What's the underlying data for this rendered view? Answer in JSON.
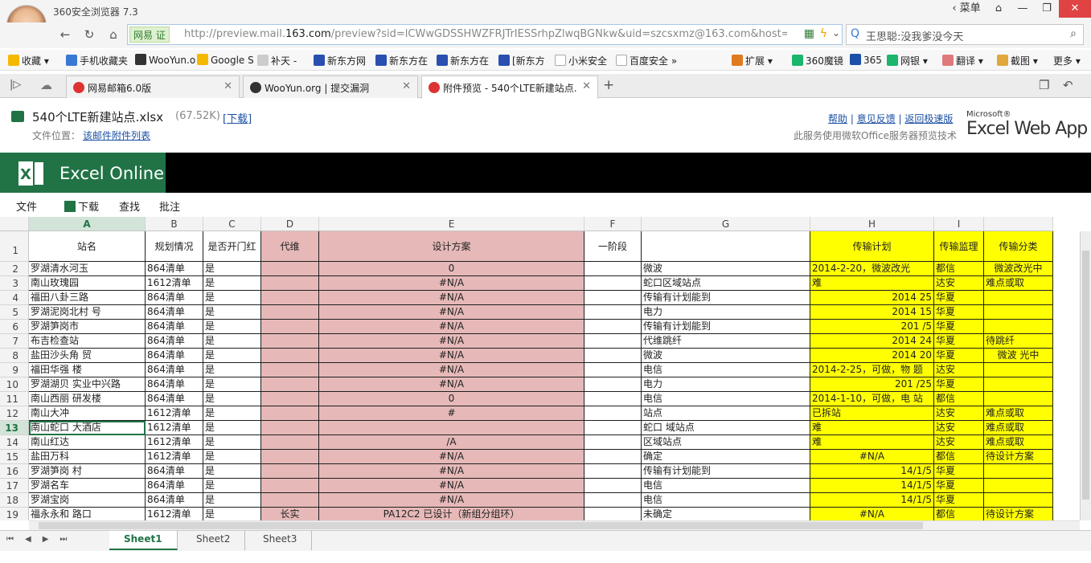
{
  "browser": {
    "app_title": "360安全浏览器 7.3",
    "url_badge": "网易 证",
    "url_prefix": "http://preview.mail.",
    "url_domain": "163.com",
    "url_suffix": "/preview?sid=lCWwGDSSHWZFRJTrIESSrhpZlwqBGNkw&uid=szcsxmz@163.com&host=",
    "search_text": "王思聪:没我爹没今天",
    "win_buttons": [
      "‹ 菜单",
      "⌂",
      "—",
      "❐",
      "✕"
    ]
  },
  "bookmarks": [
    "收藏",
    "手机收藏夹",
    "WooYun.o",
    "Google S",
    "补天",
    "新东方网",
    "新东方在",
    "新东方在",
    "[新东方",
    "小米安全",
    "百度安全",
    "扩展",
    "360魔镜",
    "365",
    "网银",
    "翻译",
    "截图",
    "更多"
  ],
  "tabs": [
    {
      "label": "网易邮箱6.0版",
      "icon_color": "#d33"
    },
    {
      "label": "WooYun.org | 提交漏洞",
      "icon_color": "#333"
    },
    {
      "label": "附件预览 - 540个LTE新建站点.",
      "icon_color": "#d33"
    }
  ],
  "file": {
    "name": "540个LTE新建站点.xlsx",
    "size": "(67.52K)",
    "download": "[下载]",
    "location_label": "文件位置：",
    "location_link": "该邮件附件列表",
    "links": [
      "帮助",
      "意见反馈",
      "返回极速版"
    ],
    "service_note": "此服务使用微软Office服务器预览技术",
    "brand_small": "Microsoft®",
    "brand_big": "Excel Web App"
  },
  "excel": {
    "title": "Excel Online",
    "menu": [
      "文件",
      "下载",
      "查找",
      "批注"
    ]
  },
  "columns": [
    "A",
    "B",
    "C",
    "D",
    "E",
    "F",
    "G",
    "H",
    "I",
    ""
  ],
  "header_row": [
    "站名",
    "规划情况",
    "是否开门红",
    "代维",
    "设计方案",
    "一阶段",
    "",
    "传输计划",
    "传输监理",
    "传输分类"
  ],
  "rows": [
    [
      "罗湖清水河玉",
      "864清单",
      "是",
      "",
      "0",
      "",
      "微波",
      "2014-2-20，微波改光",
      "都信",
      "微波改光中"
    ],
    [
      "南山玫瑰园",
      "1612清单",
      "是",
      "",
      "#N/A",
      "",
      "蛇口区域站点",
      "难",
      "达安",
      "难点或取"
    ],
    [
      "福田八卦三路",
      "864清单",
      "是",
      "",
      "#N/A",
      "",
      "传输有计划能到",
      "2014 25",
      "华夏",
      ""
    ],
    [
      "罗湖泥岗北村 号",
      "864清单",
      "是",
      "",
      "#N/A",
      "",
      "电力",
      "2014 15",
      "华夏",
      ""
    ],
    [
      "罗湖笋岗市",
      "864清单",
      "是",
      "",
      "#N/A",
      "",
      "传输有计划能到",
      "201 /5",
      "华夏",
      ""
    ],
    [
      "布吉检查站",
      "864清单",
      "是",
      "",
      "#N/A",
      "",
      "代维跳纤",
      "2014 24",
      "华夏",
      "待跳纤"
    ],
    [
      "盐田沙头角 贸",
      "864清单",
      "是",
      "",
      "#N/A",
      "",
      "微波",
      "2014 20",
      "华夏",
      "微波 光中"
    ],
    [
      "福田华强 楼",
      "864清单",
      "是",
      "",
      "#N/A",
      "",
      "电信",
      "2014-2-25，可做，物 题",
      "达安",
      ""
    ],
    [
      "罗湖湖贝 实业中兴路",
      "864清单",
      "是",
      "",
      "#N/A",
      "",
      "电力",
      "201 /25",
      "华夏",
      ""
    ],
    [
      "南山西丽 研发楼",
      "864清单",
      "是",
      "",
      "0",
      "",
      "电信",
      "2014-1-10，可做，电 站",
      "都信",
      ""
    ],
    [
      "南山大冲",
      "1612清单",
      "是",
      "",
      "#",
      "",
      "站点",
      "已拆站",
      "达安",
      "难点或取"
    ],
    [
      "南山蛇口 大酒店",
      "1612清单",
      "是",
      "",
      "",
      "",
      "蛇口 域站点",
      "难",
      "达安",
      "难点或取"
    ],
    [
      "南山红达",
      "1612清单",
      "是",
      "",
      "/A",
      "",
      "区域站点",
      "难",
      "达安",
      "难点或取"
    ],
    [
      "盐田万科",
      "1612清单",
      "是",
      "",
      "#N/A",
      "",
      "确定",
      "#N/A",
      "都信",
      "待设计方案"
    ],
    [
      "罗湖笋岗 村",
      "864清单",
      "是",
      "",
      "#N/A",
      "",
      "传输有计划能到",
      "14/1/5",
      "华夏",
      ""
    ],
    [
      "罗湖名车",
      "864清单",
      "是",
      "",
      "#N/A",
      "",
      "电信",
      "14/1/5",
      "华夏",
      ""
    ],
    [
      "罗湖宝岗",
      "864清单",
      "是",
      "",
      "#N/A",
      "",
      "电信",
      "14/1/5",
      "华夏",
      ""
    ],
    [
      "福永永和 路口",
      "1612清单",
      "是",
      "长实",
      "PA12C2  已设计（新组分组环）",
      "",
      "未确定",
      "#N/A",
      "都信",
      "待设计方案"
    ]
  ],
  "row_numbers": [
    "1",
    "2",
    "3",
    "4",
    "5",
    "6",
    "7",
    "8",
    "9",
    "10",
    "11",
    "12",
    "13",
    "14",
    "15",
    "16",
    "17",
    "18",
    "19"
  ],
  "sheets": [
    "Sheet1",
    "Sheet2",
    "Sheet3"
  ]
}
